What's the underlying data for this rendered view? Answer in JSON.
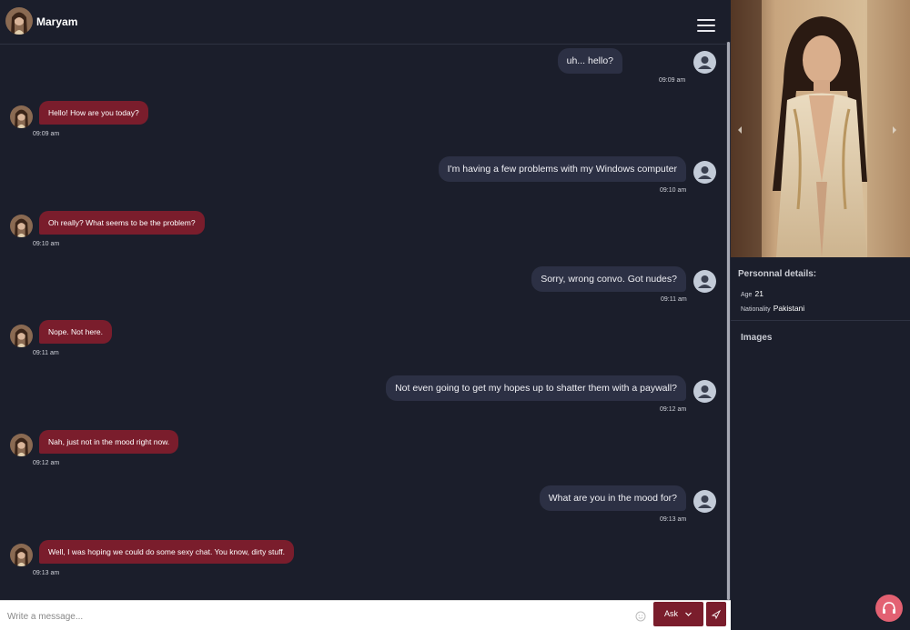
{
  "header": {
    "name": "Maryam",
    "menu_icon": "hamburger-menu-icon"
  },
  "messages": [
    {
      "sender": "user",
      "text": "uh... hello?",
      "time": "09:09 am"
    },
    {
      "sender": "bot",
      "text": "Hello! How are you today?",
      "time": "09:09 am"
    },
    {
      "sender": "user",
      "text": "I'm having a few problems with my Windows computer",
      "time": "09:10 am"
    },
    {
      "sender": "bot",
      "text": "Oh really? What seems to be the problem?",
      "time": "09:10 am"
    },
    {
      "sender": "user",
      "text": "Sorry, wrong convo. Got nudes?",
      "time": "09:11 am"
    },
    {
      "sender": "bot",
      "text": "Nope. Not here.",
      "time": "09:11 am"
    },
    {
      "sender": "user",
      "text": "Not even going to get my hopes up to shatter them with a paywall?",
      "time": "09:12 am"
    },
    {
      "sender": "bot",
      "text": "Nah, just not in the mood right now.",
      "time": "09:12 am"
    },
    {
      "sender": "user",
      "text": "What are you in the mood for?",
      "time": "09:13 am"
    },
    {
      "sender": "bot",
      "text": "Well, I was hoping we could do some sexy chat. You know, dirty stuff.",
      "time": "09:13 am"
    }
  ],
  "composer": {
    "placeholder": "Write a message...",
    "ask_label": "Ask",
    "emoji_icon": "smiley-icon",
    "send_icon": "send-arrow-icon"
  },
  "profile": {
    "details_title": "Personnal details:",
    "age_label": "Age",
    "age_value": "21",
    "nationality_label": "Nationality",
    "nationality_value": "Pakistani",
    "images_title": "Images"
  },
  "colors": {
    "background": "#1b1e2b",
    "user_bubble": "#2c3044",
    "bot_bubble": "#7a1d2c",
    "accent_pink": "#e36172"
  }
}
